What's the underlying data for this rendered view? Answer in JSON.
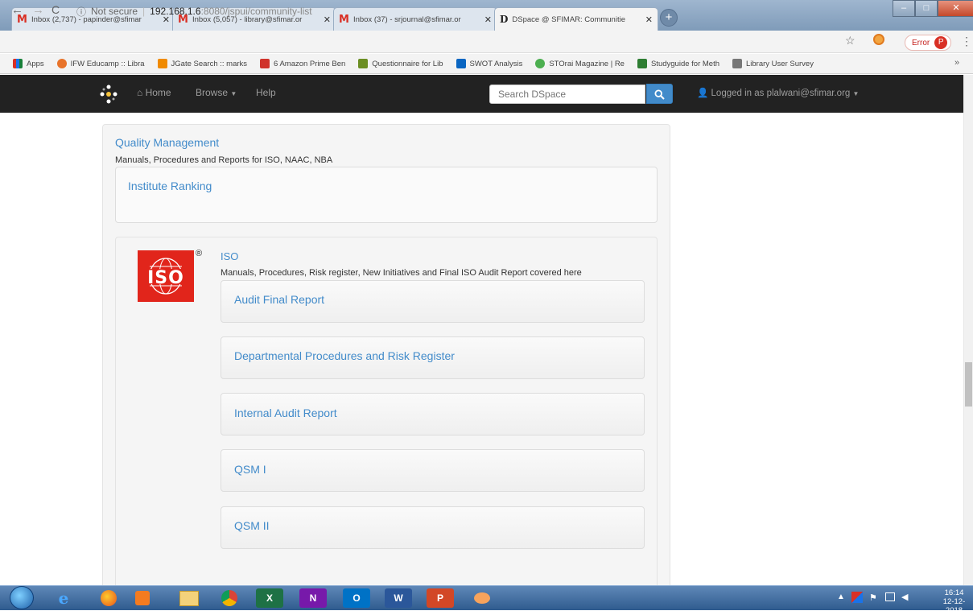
{
  "browser": {
    "tabs": [
      {
        "icon": "gmail-icon",
        "title": "Inbox (2,737) - papinder@sfimar",
        "active": false
      },
      {
        "icon": "gmail-icon",
        "title": "Inbox (5,057) - library@sfimar.or",
        "active": false
      },
      {
        "icon": "gmail-icon",
        "title": "Inbox (37) - srjournal@sfimar.or",
        "active": false
      },
      {
        "icon": "dspace-icon",
        "title": "DSpace @ SFIMAR: Communitie",
        "active": true
      }
    ],
    "address": {
      "security": "Not secure",
      "host": "192.168.1.6",
      "path": ":8080/jspui/community-list"
    },
    "error_label": "Error",
    "profile_initial": "P",
    "bookmarks": [
      {
        "label": "Apps",
        "color": "#3a7bd5"
      },
      {
        "label": "IFW Educamp :: Libra",
        "color": "#e8732a"
      },
      {
        "label": "JGate Search :: marks",
        "color": "#f08a00"
      },
      {
        "label": "6 Amazon Prime Ben",
        "color": "#d0342c"
      },
      {
        "label": "Questionnaire for Lib",
        "color": "#6b8e23"
      },
      {
        "label": "SWOT Analysis",
        "color": "#0a66c2"
      },
      {
        "label": "STOrai Magazine | Re",
        "color": "#4caf50"
      },
      {
        "label": "Studyguide for Meth",
        "color": "#2e7d32"
      },
      {
        "label": "Library User Survey",
        "color": "#777777"
      }
    ],
    "more_bookmarks": "»"
  },
  "navbar": {
    "home": "Home",
    "browse": "Browse",
    "help": "Help",
    "search_placeholder": "Search DSpace",
    "logged_in": "Logged in as plalwani@sfimar.org"
  },
  "community": {
    "title": "Quality Management",
    "description": "Manuals, Procedures and Reports for ISO, NAAC, NBA",
    "subcommunities": [
      {
        "title": "Institute Ranking"
      }
    ],
    "iso": {
      "logo_text": "ISO",
      "title": "ISO",
      "description": "Manuals, Procedures, Risk register, New Initiatives and Final ISO Audit Report covered here",
      "collections": [
        {
          "title": "Audit Final Report"
        },
        {
          "title": "Departmental Procedures and Risk Register"
        },
        {
          "title": "Internal Audit Report"
        },
        {
          "title": "QSM I"
        },
        {
          "title": "QSM II"
        }
      ]
    }
  },
  "taskbar": {
    "apps": [
      "start-orb",
      "internet-explorer",
      "firefox",
      "media-player",
      "file-explorer",
      "chrome",
      "excel",
      "onenote",
      "outlook",
      "word",
      "powerpoint",
      "toolbar-app"
    ],
    "time": "16:14",
    "date": "12-12-2018"
  }
}
